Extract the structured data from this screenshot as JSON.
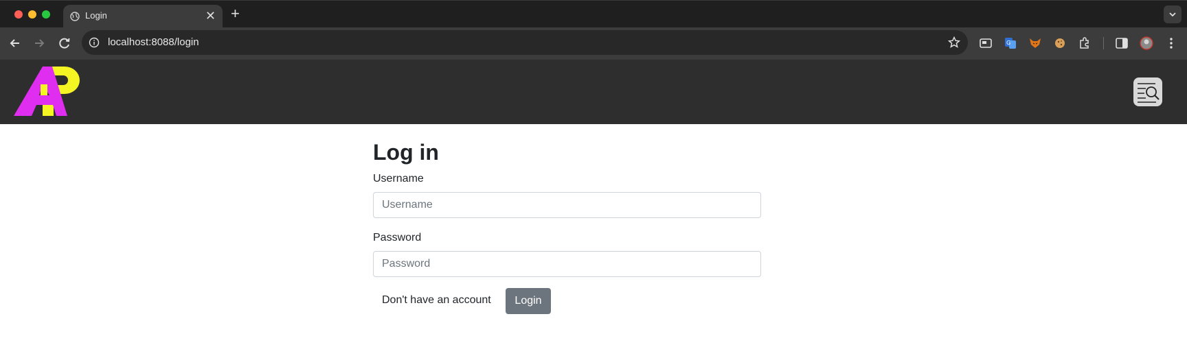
{
  "browser": {
    "tab_title": "Login",
    "tab_close": "✕",
    "new_tab": "+",
    "url": "localhost:8088/login"
  },
  "icons": {
    "tab_favicon": "globe-icon",
    "back": "arrow-left-icon",
    "forward": "arrow-right-icon",
    "reload": "reload-icon",
    "site_info": "info-icon",
    "bookmark": "star-icon",
    "menu": "search-list-icon"
  },
  "form": {
    "title": "Log in",
    "username_label": "Username",
    "username_placeholder": "Username",
    "username_value": "",
    "password_label": "Password",
    "password_placeholder": "Password",
    "password_value": "",
    "register_link": "Don't have an account",
    "login_button": "Login"
  },
  "colors": {
    "header_bg": "#2e2e2e",
    "logo_magenta": "#e02ef0",
    "logo_yellow": "#f5f523",
    "button_bg": "#6c757d"
  }
}
